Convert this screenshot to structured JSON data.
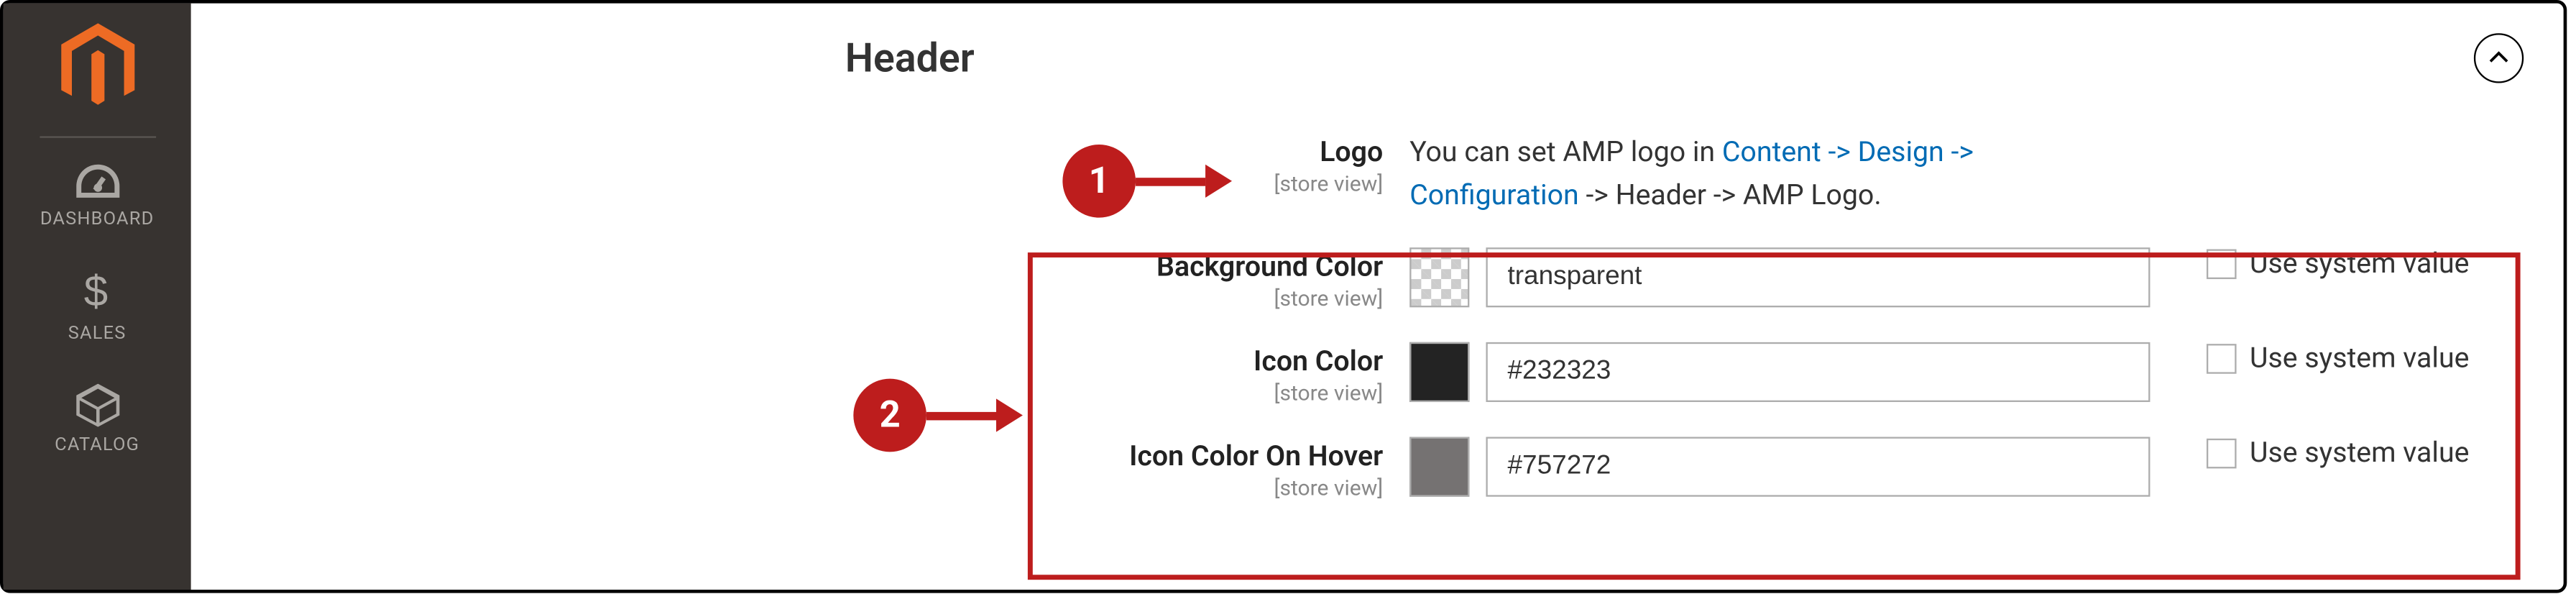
{
  "sidebar": {
    "items": [
      {
        "label": "DASHBOARD"
      },
      {
        "label": "SALES"
      },
      {
        "label": "CATALOG"
      }
    ]
  },
  "section": {
    "title": "Header"
  },
  "fields": {
    "logo": {
      "label": "Logo",
      "scope": "[store view]",
      "desc_prefix": "You can set AMP logo in ",
      "link_text": "Content -> Design -> Configuration",
      "desc_suffix": " -> Header -> AMP Logo."
    },
    "bg": {
      "label": "Background Color",
      "scope": "[store view]",
      "value": "transparent",
      "useSystemLabel": "Use system value"
    },
    "iconColor": {
      "label": "Icon Color",
      "scope": "[store view]",
      "value": "#232323",
      "swatch": "#232323",
      "useSystemLabel": "Use system value"
    },
    "iconHover": {
      "label": "Icon Color On Hover",
      "scope": "[store view]",
      "value": "#757272",
      "swatch": "#757272",
      "useSystemLabel": "Use system value"
    }
  },
  "annotations": {
    "one": "1",
    "two": "2"
  }
}
